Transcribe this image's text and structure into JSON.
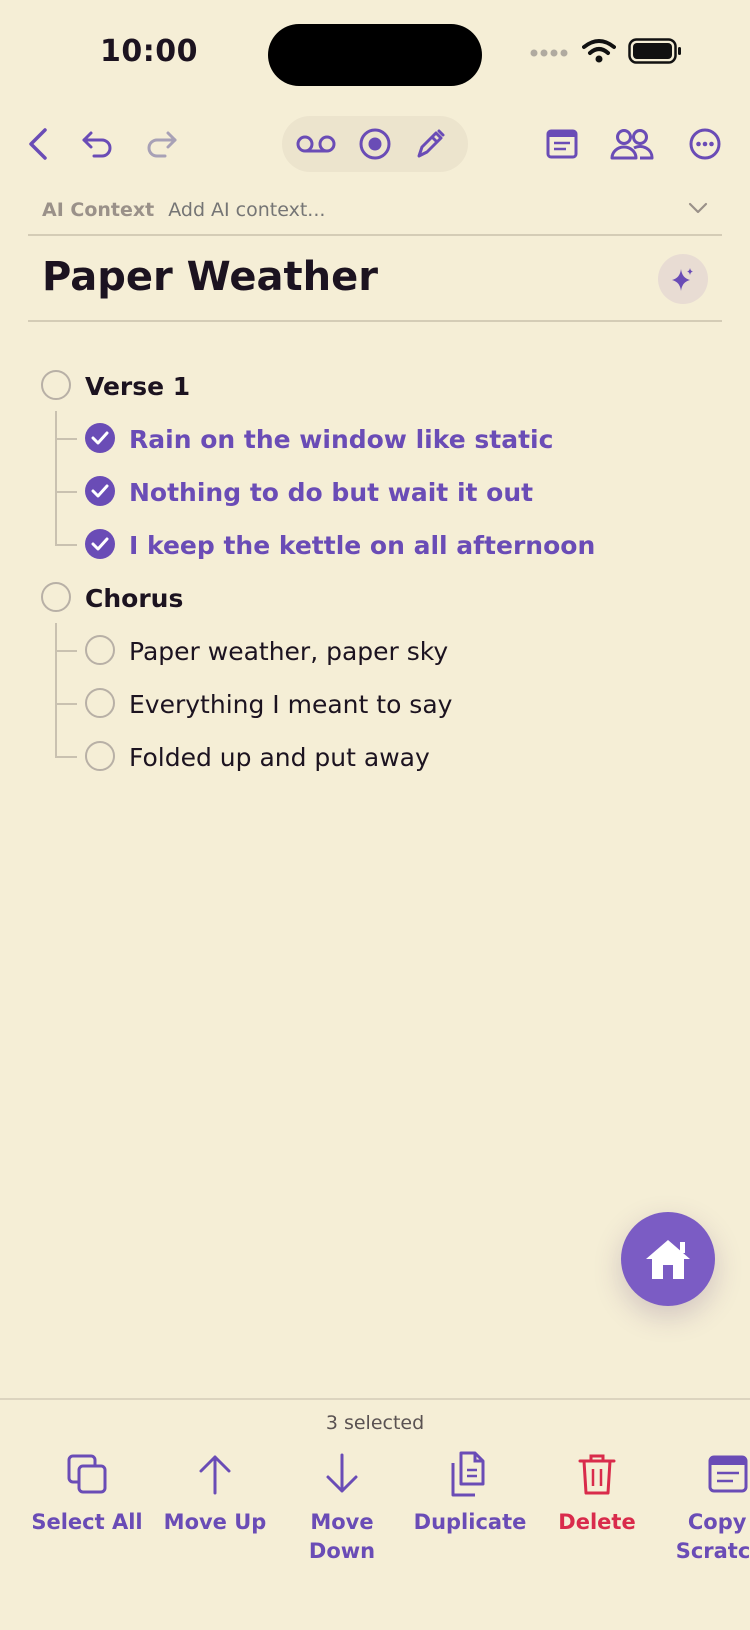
{
  "status": {
    "time": "10:00"
  },
  "ai_context": {
    "label": "AI Context",
    "placeholder": "Add AI context..."
  },
  "note": {
    "title": "Paper Weather"
  },
  "items": [
    {
      "text": "Verse 1"
    },
    {
      "text": "Rain on the window like static"
    },
    {
      "text": "Nothing to do but wait it out"
    },
    {
      "text": "I keep the kettle on all afternoon"
    },
    {
      "text": "Chorus"
    },
    {
      "text": "Paper weather, paper sky"
    },
    {
      "text": "Everything I meant to say"
    },
    {
      "text": "Folded up and put away"
    }
  ],
  "selection": {
    "count_label": "3 selected"
  },
  "actions": {
    "select_all": "Select All",
    "move_up": "Move Up",
    "move_down": "Move\nDown",
    "duplicate": "Duplicate",
    "delete": "Delete",
    "copy_to_scratchpad": "Copy T\nScratchp"
  },
  "colors": {
    "accent": "#6a4cb6",
    "danger": "#d92b4b",
    "background": "#f5eed6"
  }
}
